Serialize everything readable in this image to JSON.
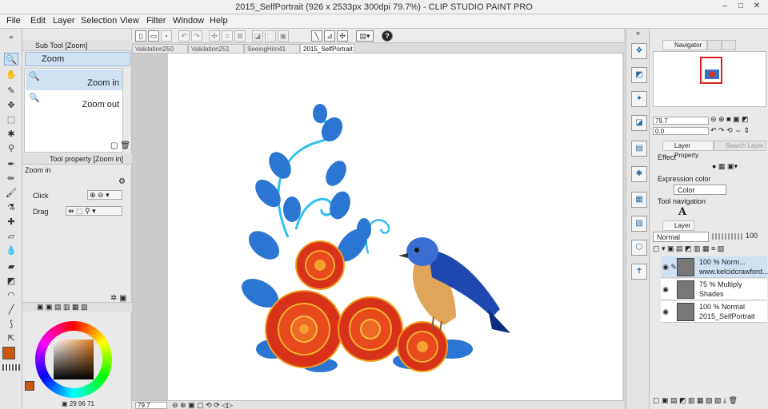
{
  "window": {
    "title": "2015_SelfPortrait (926 x 2533px 300dpi 79.7%) - CLIP STUDIO PAINT PRO",
    "minimize": "–",
    "maximize": "□",
    "close": "✕"
  },
  "menu": [
    "File",
    "Edit",
    "Layer",
    "Selection",
    "View",
    "Filter",
    "Window",
    "Help"
  ],
  "sub_tool": {
    "header": "Sub Tool [Zoom]",
    "group": "Zoom",
    "options": [
      {
        "label": "Zoom in",
        "selected": true
      },
      {
        "label": "Zoom out",
        "selected": false
      }
    ]
  },
  "tool_property": {
    "header": "Tool property [Zoom in]",
    "name": "Zoom in",
    "click_label": "Click",
    "drag_label": "Drag"
  },
  "color": {
    "main": "#c8570c",
    "h": "29",
    "s": "96",
    "v": "71"
  },
  "tabs": [
    {
      "label": "Validation250",
      "active": false
    },
    {
      "label": "Validation251",
      "active": false
    },
    {
      "label": "SeeingHim41",
      "active": false
    },
    {
      "label": "2015_SelfPortrait",
      "active": true
    }
  ],
  "status": {
    "zoom": "79.7"
  },
  "navigator": {
    "tab": "Navigator",
    "zoom": "79.7",
    "rotation": "0.0"
  },
  "layer_property": {
    "tab": "Layer Property",
    "search_tab": "Search Layer",
    "effect_label": "Effect",
    "expression_label": "Expression color",
    "expression_value": "Color",
    "tool_nav_label": "Tool navigation"
  },
  "layers_panel": {
    "tab": "Layer",
    "blend_mode": "Normal",
    "opacity": "100",
    "layers": [
      {
        "line1": "100 %  Norm...",
        "line2": "www.kelcidcrawford...",
        "selected": true
      },
      {
        "line1": "75 %  Multiply",
        "line2": "Shades",
        "selected": false
      },
      {
        "line1": "100 %  Normal",
        "line2": "2015_SelfPortrait",
        "selected": false
      }
    ]
  }
}
